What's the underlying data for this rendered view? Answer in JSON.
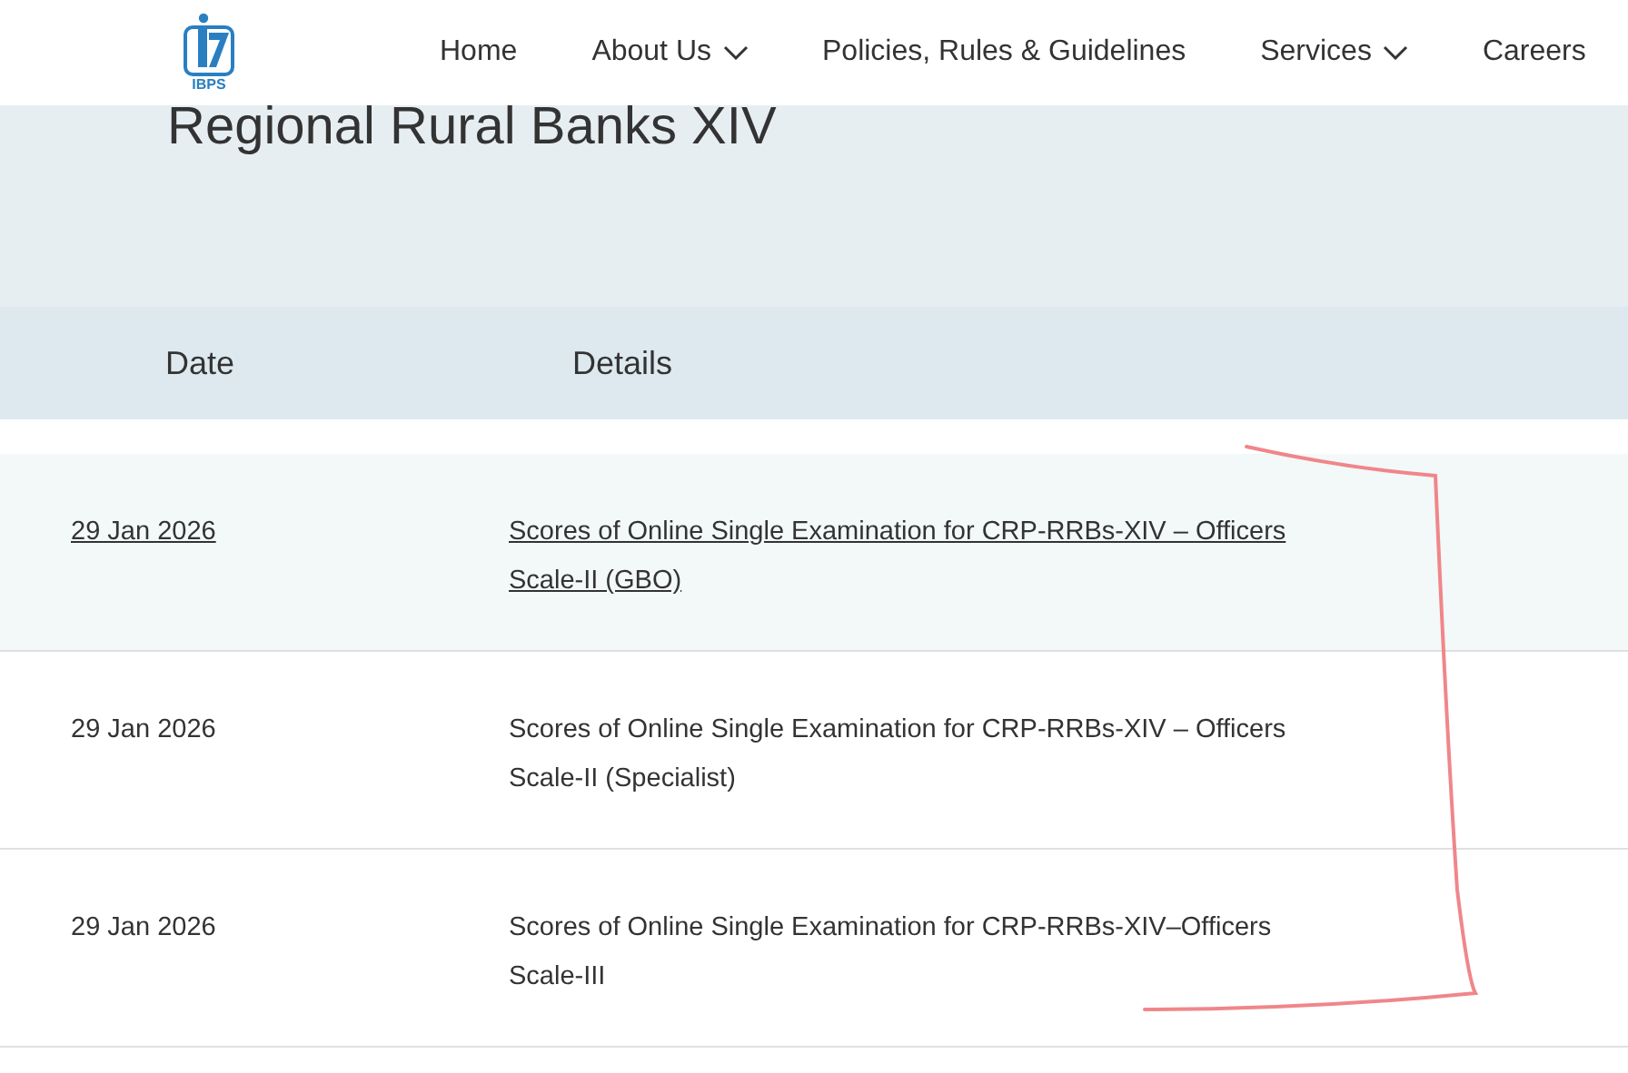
{
  "logo": {
    "text": "IBPS"
  },
  "nav": [
    {
      "label": "Home",
      "dropdown": false
    },
    {
      "label": "About Us",
      "dropdown": true
    },
    {
      "label": "Policies, Rules & Guidelines",
      "dropdown": false
    },
    {
      "label": "Services",
      "dropdown": true
    },
    {
      "label": "Careers",
      "dropdown": false
    }
  ],
  "page_title": "Regional Rural Banks XIV",
  "table": {
    "columns": [
      "Date",
      "Details"
    ],
    "rows": [
      {
        "date": "29 Jan 2026",
        "details": "Scores of Online Single Examination for CRP-RRBs-XIV – Officers Scale-II (GBO)",
        "highlighted": true
      },
      {
        "date": "29 Jan 2026",
        "details": "Scores of Online Single Examination for CRP-RRBs-XIV – Officers Scale-II (Specialist)",
        "highlighted": false
      },
      {
        "date": "29 Jan 2026",
        "details": "Scores of Online Single Examination for CRP-RRBs-XIV–Officers Scale-III",
        "highlighted": false
      }
    ]
  }
}
